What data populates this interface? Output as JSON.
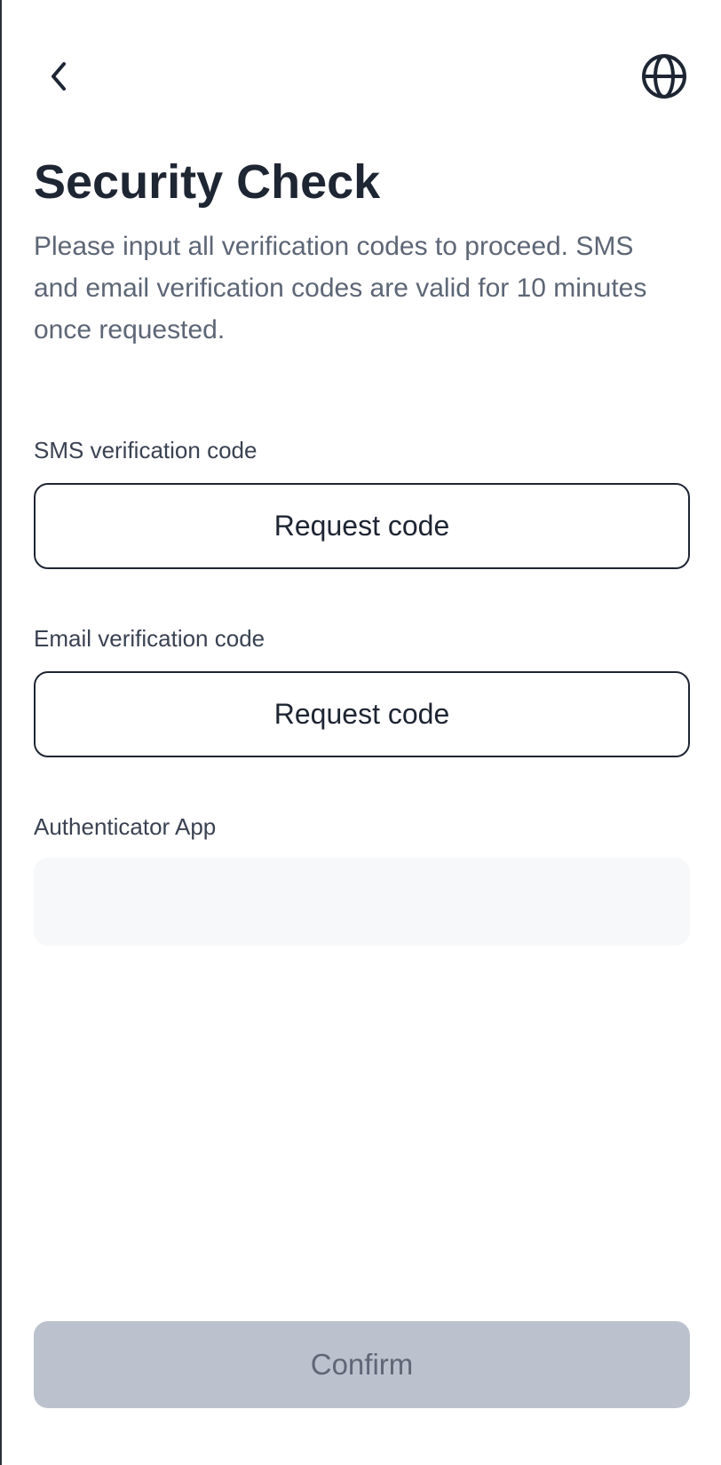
{
  "header": {
    "back_icon": "chevron-left-icon",
    "language_icon": "globe-icon"
  },
  "title": "Security Check",
  "subtitle": "Please input all verification codes to proceed. SMS and email verification codes are valid for 10 minutes once requested.",
  "fields": {
    "sms": {
      "label": "SMS verification code",
      "button_label": "Request code"
    },
    "email": {
      "label": "Email verification code",
      "button_label": "Request code"
    },
    "authenticator": {
      "label": "Authenticator App",
      "value": "",
      "placeholder": ""
    }
  },
  "confirm": {
    "label": "Confirm",
    "enabled": false
  },
  "colors": {
    "text_primary": "#1e2533",
    "text_secondary": "#5d6676",
    "input_background": "#f7f8fa",
    "confirm_disabled_bg": "#bcc2cd",
    "confirm_disabled_text": "#5f6776"
  }
}
